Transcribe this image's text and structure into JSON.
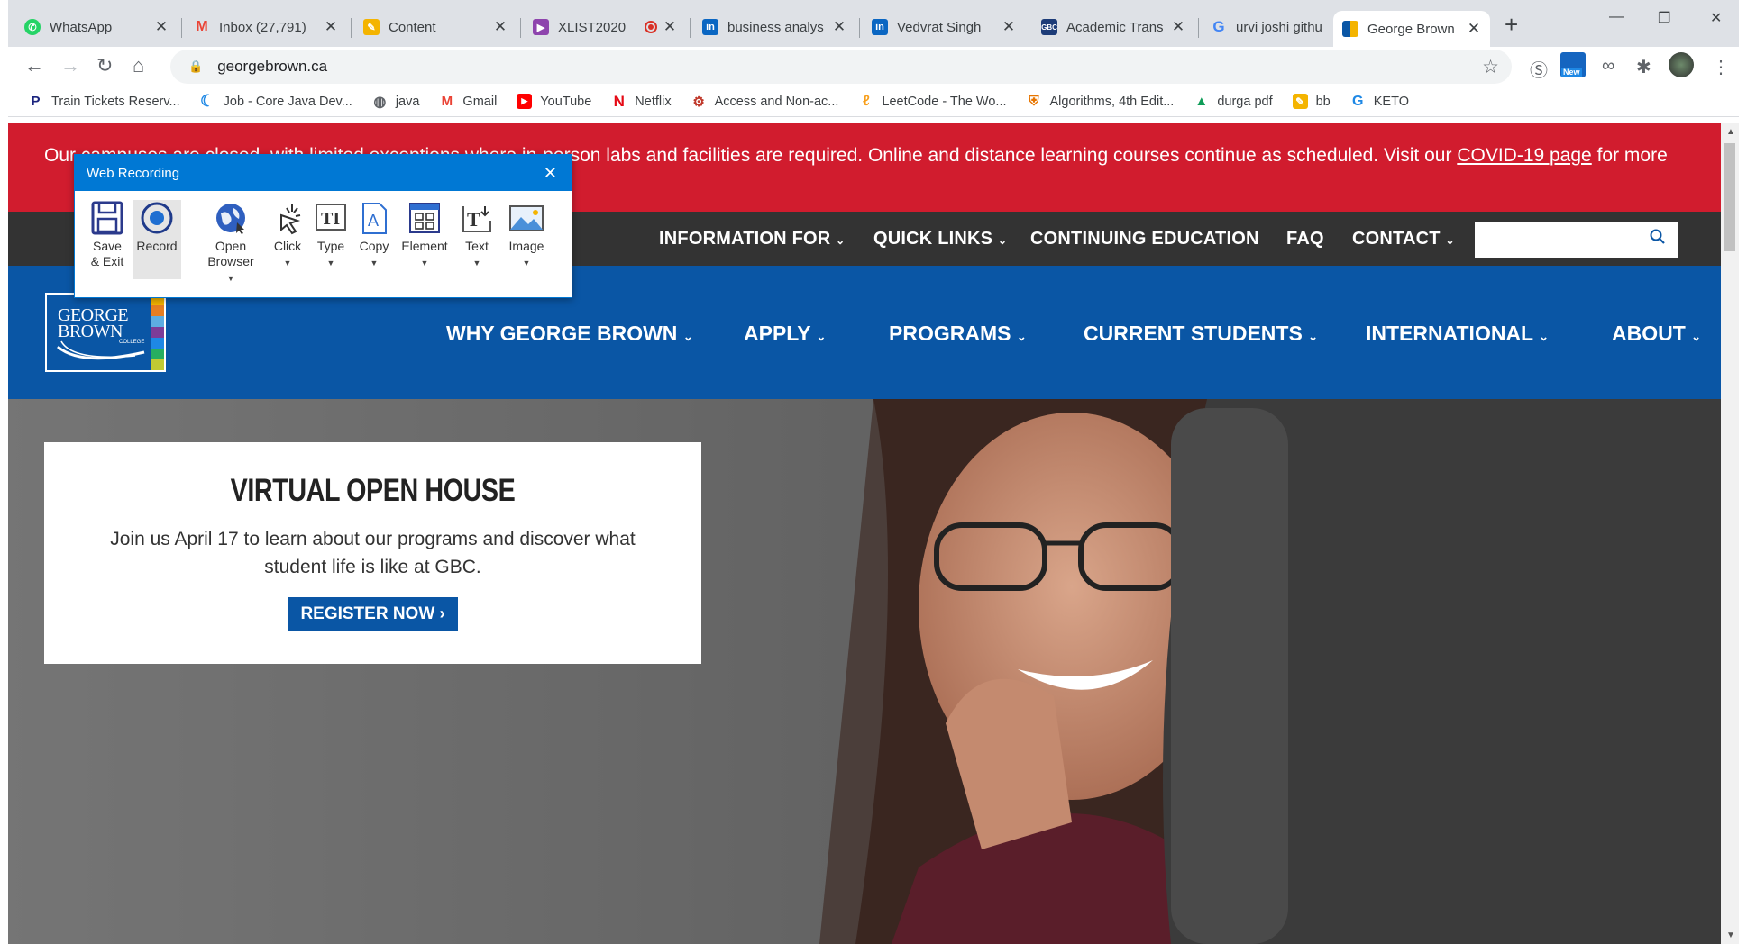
{
  "browser": {
    "tabs": [
      {
        "title": "WhatsApp",
        "icon": "whatsapp-icon",
        "color": "#25d366"
      },
      {
        "title": "Inbox (27,791)",
        "icon": "gmail-icon",
        "color": "#ea4335"
      },
      {
        "title": "Content",
        "icon": "content-icon",
        "color": "#f4b400"
      },
      {
        "title": "XLIST2020",
        "icon": "xlist-icon",
        "color": "#8e44ad"
      },
      {
        "title": "business analys",
        "icon": "linkedin-icon",
        "color": "#0a66c2"
      },
      {
        "title": "Vedvrat Singh",
        "icon": "linkedin-icon",
        "color": "#0a66c2"
      },
      {
        "title": "Academic Trans",
        "icon": "gbc-icon",
        "color": "#1d3c78"
      },
      {
        "title": "urvi joshi githu",
        "icon": "google-icon",
        "color": "#4285f4"
      },
      {
        "title": "George Brown",
        "icon": "george-brown-icon",
        "color": "#0a56a5"
      }
    ],
    "url": "georgebrown.ca",
    "ext_badge": "New",
    "bookmarks": [
      {
        "label": "Train Tickets Reserv...",
        "icon": "train-icon"
      },
      {
        "label": "Job - Core Java Dev...",
        "icon": "job-icon"
      },
      {
        "label": "java",
        "icon": "globe-icon"
      },
      {
        "label": "Gmail",
        "icon": "gmail-icon"
      },
      {
        "label": "YouTube",
        "icon": "youtube-icon"
      },
      {
        "label": "Netflix",
        "icon": "netflix-icon"
      },
      {
        "label": "Access and Non-ac...",
        "icon": "access-icon"
      },
      {
        "label": "LeetCode - The Wo...",
        "icon": "leetcode-icon"
      },
      {
        "label": "Algorithms, 4th Edit...",
        "icon": "princeton-icon"
      },
      {
        "label": "durga pdf",
        "icon": "drive-icon"
      },
      {
        "label": "bb",
        "icon": "bb-icon"
      },
      {
        "label": "KETO",
        "icon": "keto-icon"
      }
    ]
  },
  "site": {
    "covid_text": "Our campuses are closed, with limited exceptions where in-person labs and facilities are required. Online and distance learning courses continue as scheduled. Visit our",
    "covid_link": "COVID-19 page",
    "covid_tail": "for more",
    "utility_nav": [
      "INFORMATION FOR",
      "QUICK LINKS",
      "CONTINUING EDUCATION",
      "FAQ",
      "CONTACT"
    ],
    "logo_text": [
      "GEORGE",
      "BROWN"
    ],
    "logo_sub": "COLLEGE",
    "main_nav": [
      "WHY GEORGE BROWN",
      "APPLY",
      "PROGRAMS",
      "CURRENT STUDENTS",
      "INTERNATIONAL",
      "ABOUT"
    ],
    "promo_title": "VIRTUAL OPEN HOUSE",
    "promo_text": "Join us April 17 to learn about our programs and discover what student life is like at GBC.",
    "promo_button": "REGISTER NOW"
  },
  "recorder": {
    "title": "Web Recording",
    "tools": [
      {
        "label": "Save\n& Exit",
        "icon": "save-icon"
      },
      {
        "label": "Record",
        "icon": "record-icon"
      },
      {
        "label": "Open\nBrowser",
        "icon": "browser-icon"
      },
      {
        "label": "Click",
        "icon": "click-icon"
      },
      {
        "label": "Type",
        "icon": "type-icon"
      },
      {
        "label": "Copy",
        "icon": "copy-icon"
      },
      {
        "label": "Element",
        "icon": "element-icon"
      },
      {
        "label": "Text",
        "icon": "text-icon"
      },
      {
        "label": "Image",
        "icon": "image-icon"
      }
    ]
  }
}
